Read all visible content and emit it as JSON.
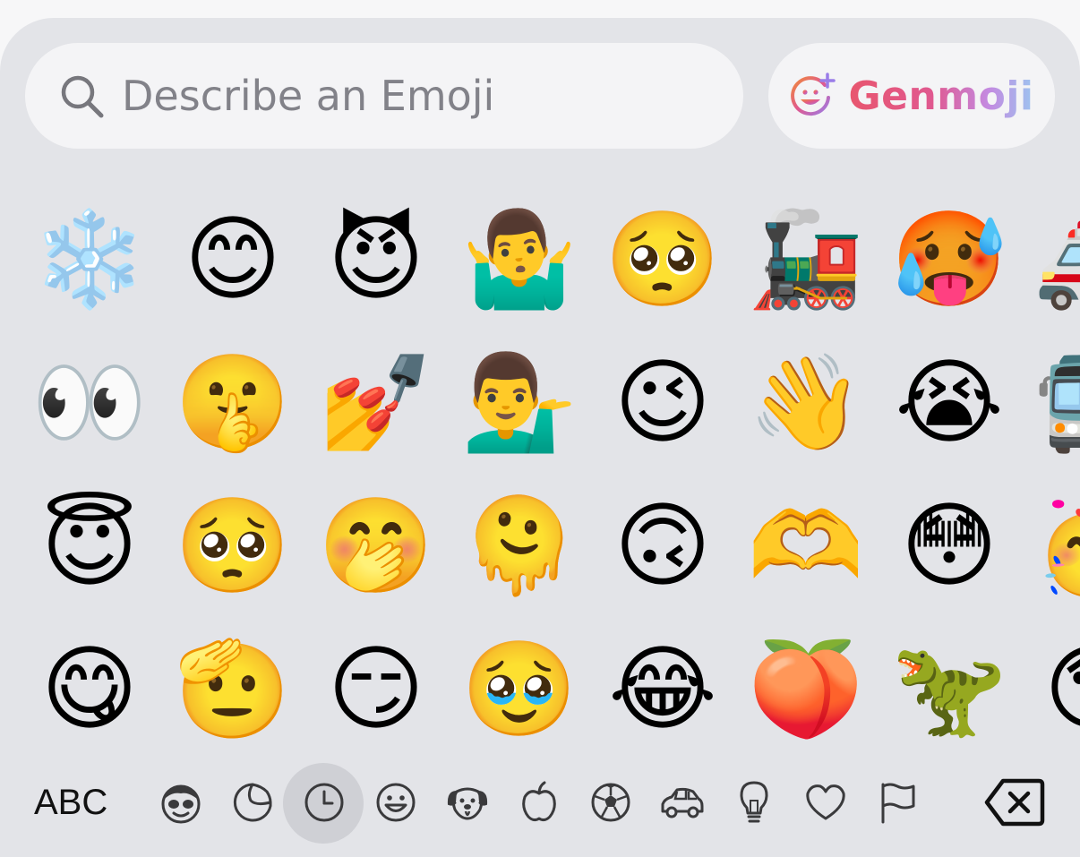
{
  "search": {
    "placeholder": "Describe an Emoji",
    "value": ""
  },
  "genmoji": {
    "label": "Genmoji"
  },
  "emoji_grid": {
    "columns": [
      [
        "❄️",
        "👀",
        "😇",
        "😋"
      ],
      [
        "😊",
        "🤫",
        "🥺",
        "🫡"
      ],
      [
        "😈",
        "💅",
        "🤭",
        "😏"
      ],
      [
        "🤷‍♂️",
        "💁‍♂️",
        "🫠",
        "🥹"
      ],
      [
        "🥺",
        "😉",
        "🙃",
        "😂"
      ],
      [
        "🚂",
        "👋",
        "🫶",
        "🍑"
      ],
      [
        "🥵",
        "😭",
        "😳",
        "🦖"
      ],
      [
        "🚑",
        "🚍",
        "🥳",
        "😰"
      ]
    ]
  },
  "bottom_bar": {
    "abc_label": "ABC",
    "categories": [
      {
        "name": "smileys-people",
        "icon": "face-with-sunglasses-icon"
      },
      {
        "name": "stickers",
        "icon": "sticker-icon"
      },
      {
        "name": "frequently-used",
        "icon": "clock-icon",
        "selected": true
      },
      {
        "name": "smileys",
        "icon": "smiley-face-icon"
      },
      {
        "name": "animals-nature",
        "icon": "dog-icon"
      },
      {
        "name": "food-drink",
        "icon": "apple-icon"
      },
      {
        "name": "activity",
        "icon": "soccer-ball-icon"
      },
      {
        "name": "travel-places",
        "icon": "car-icon"
      },
      {
        "name": "objects",
        "icon": "lightbulb-icon"
      },
      {
        "name": "symbols",
        "icon": "heart-icon"
      },
      {
        "name": "flags",
        "icon": "flag-icon"
      }
    ],
    "delete_icon": "delete-backspace-icon"
  },
  "colors": {
    "keyboard_background": "#e3e4e8",
    "field_background": "#f4f4f6",
    "placeholder_text": "#828289",
    "icon_stroke": "#3a3a3c",
    "selected_category_background": "#cfd0d5",
    "genmoji_gradient": [
      "#e8566e",
      "#e0588f",
      "#c489e0",
      "#9cc4f0"
    ]
  }
}
